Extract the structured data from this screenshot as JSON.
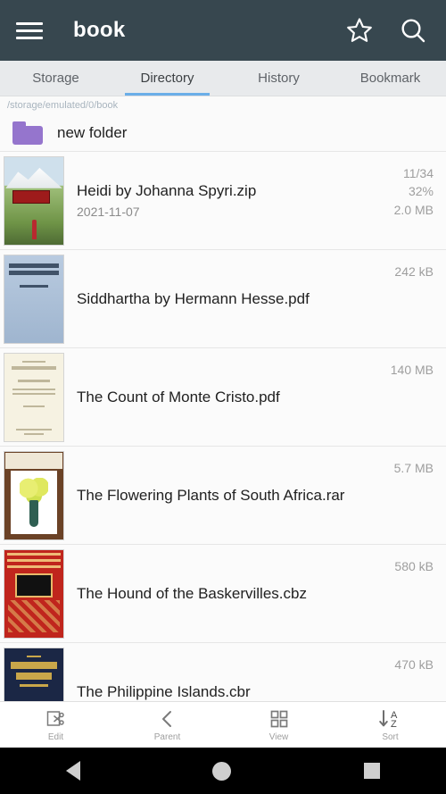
{
  "appbar": {
    "title": "book",
    "menu_icon": "hamburger-menu-icon",
    "bookmark_icon": "star-icon",
    "search_icon": "search-icon"
  },
  "tabs": [
    {
      "label": "Storage",
      "active": false
    },
    {
      "label": "Directory",
      "active": true
    },
    {
      "label": "History",
      "active": false
    },
    {
      "label": "Bookmark",
      "active": false
    }
  ],
  "path": "/storage/emulated/0/book",
  "folder": {
    "name": "new folder",
    "icon": "folder-icon"
  },
  "files": [
    {
      "name": "Heidi by Johanna Spyri.zip",
      "date": "2021-11-07",
      "pages": "11/34",
      "percent": "32%",
      "size": "2.0 MB",
      "cover": "heidi"
    },
    {
      "name": "Siddhartha by Hermann Hesse.pdf",
      "date": "",
      "pages": "",
      "percent": "",
      "size": "242 kB",
      "cover": "siddhartha"
    },
    {
      "name": "The Count of Monte Cristo.pdf",
      "date": "",
      "pages": "",
      "percent": "",
      "size": "140 MB",
      "cover": "montecristo"
    },
    {
      "name": "The Flowering Plants of South Africa.rar",
      "date": "",
      "pages": "",
      "percent": "",
      "size": "5.7 MB",
      "cover": "flowering"
    },
    {
      "name": "The Hound of the Baskervilles.cbz",
      "date": "",
      "pages": "",
      "percent": "",
      "size": "580 kB",
      "cover": "hound"
    },
    {
      "name": "The Philippine Islands.cbr",
      "date": "",
      "pages": "",
      "percent": "",
      "size": "470 kB",
      "cover": "philippine"
    }
  ],
  "toolbar": [
    {
      "label": "Edit",
      "icon": "cut-scissors-icon"
    },
    {
      "label": "Parent",
      "icon": "chevron-left-icon"
    },
    {
      "label": "View",
      "icon": "grid-view-icon"
    },
    {
      "label": "Sort",
      "icon": "sort-az-icon"
    }
  ],
  "navbar": {
    "back": "back-triangle-icon",
    "home": "home-circle-icon",
    "recent": "recents-square-icon"
  },
  "colors": {
    "appbar": "#37474f",
    "tab_bar": "#e8eaec",
    "tab_indicator": "#6aaee8",
    "folder": "#9575cd",
    "path_text": "#a8b4be"
  }
}
